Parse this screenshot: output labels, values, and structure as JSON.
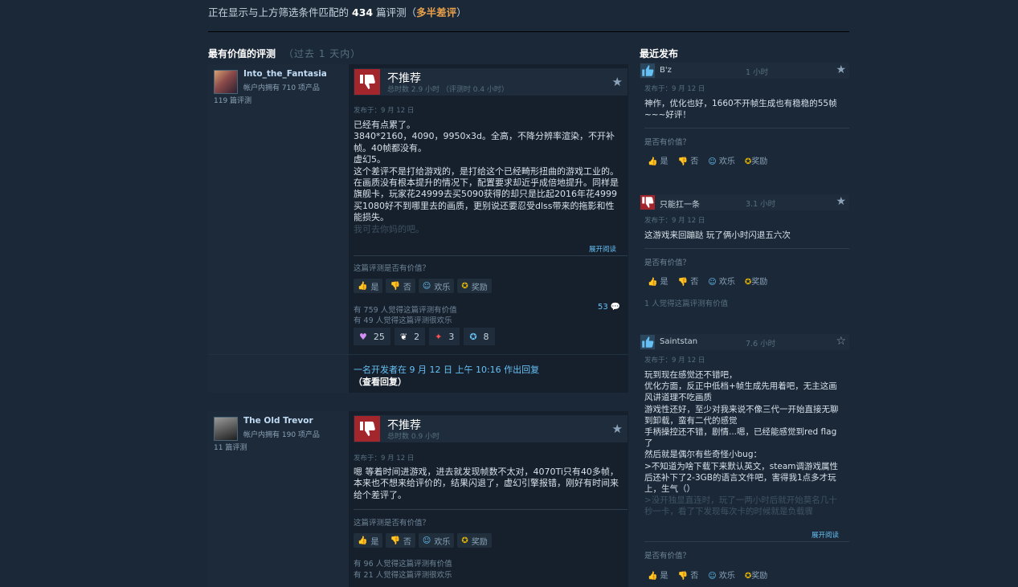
{
  "filter": {
    "prefix": "正在显示与上方筛选条件匹配的",
    "count": "434",
    "suffix": "篇评测（",
    "rating": "多半差评",
    "close": "）"
  },
  "most_helpful": {
    "title": "最有价值的评测",
    "subtitle": "（过去 1 天内）"
  },
  "reviews": [
    {
      "author": "Into_the_Fantasia",
      "owned": "帐户内拥有 710 项产品",
      "num_reviews": "119 篇评测",
      "verdict": "不推荐",
      "hours": "总时数 2.9 小时 （评测时 0.4 小时）",
      "posted": "发布于：9 月 12 日",
      "lines": [
        "已经有点累了。",
        "3840*2160，4090，9950x3d。全高，不降分辨率渲染，不开补帧。40帧都没有。",
        "虚幻5。",
        "这个差评不是打给游戏的，是打给这个已经畸形扭曲的游戏工业的。在画质没有根本提升的情况下，配置要求却近乎成倍地提升。同样是旗舰卡，玩家花24999去买5090获得的却只是比起2016年花4999买1080好不到哪里去的画质，更别说还要忍受dlss带来的拖影和性能损失。"
      ],
      "faded": "我可去你妈的吧。",
      "expand": "展开阅读",
      "helpful_q": "这篇评测是否有价值？",
      "btn_yes": "是",
      "btn_no": "否",
      "btn_funny": "欢乐",
      "btn_award": "奖励",
      "stat_helpful": "有 759 人觉得这篇评测有价值",
      "stat_funny": "有 49 人觉得这篇评测很欢乐",
      "comments": "53",
      "reactions": [
        "25",
        "2",
        "3",
        "8"
      ],
      "dev_reply": "一名开发者在 9 月 12 日 上午 10:16 作出回复",
      "view_reply": "（查看回复）"
    },
    {
      "author": "The Old Trevor",
      "owned": "帐户内拥有 190 项产品",
      "num_reviews": "11 篇评测",
      "verdict": "不推荐",
      "hours": "总时数 0.9 小时",
      "posted": "发布于：9 月 12 日",
      "lines": [
        "嗯 等着时间进游戏，进去就发现帧数不太对，4070Ti只有40多帧，本来也不想来给评价的，结果闪退了，虚幻引擎报错，刚好有时间来给个差评了。"
      ],
      "helpful_q": "这篇评测是否有价值？",
      "btn_yes": "是",
      "btn_no": "否",
      "btn_funny": "欢乐",
      "btn_award": "奖励",
      "stat_helpful": "有 96 人觉得这篇评测有价值",
      "stat_funny": "有 21 人觉得这篇评测很欢乐"
    }
  ],
  "recent": {
    "title": "最近发布",
    "items": [
      {
        "name": "B'z",
        "hours": "1 小时",
        "posted": "发布于：9 月 12 日",
        "lines": [
          "神作，优化也好，1660不开帧生成也有稳稳的55帧~~~好评！"
        ],
        "helpful_q": "是否有价值？",
        "yes": "是",
        "no": "否",
        "funny": "欢乐",
        "award": "奖励"
      },
      {
        "name": "只能扛一条",
        "hours": "3.1 小时",
        "posted": "发布于：9 月 12 日",
        "lines": [
          "这游戏来回蹦跶 玩了俩小时闪退五六次"
        ],
        "helpful_q": "是否有价值？",
        "yes": "是",
        "no": "否",
        "funny": "欢乐",
        "award": "奖励",
        "stat": "1 人觉得这篇评测有价值"
      },
      {
        "name": "Saintstan",
        "hours": "7.6 小时",
        "posted": "发布于：9 月 12 日",
        "lines": [
          "玩到现在感觉还不错吧，",
          "优化方面，反正中低档+帧生成先用着吧，无主这画风讲道理不吃画质",
          "游戏性还好，至少对我来说不像三代一开始直接无聊到卸载，蛮有二代的感觉",
          "手柄操控还不错，剧情...嗯，已经能感觉到red flag了",
          "然后就是偶尔有些奇怪小bug：",
          ">不知道为啥下载下来默认英文，steam调游戏属性后还补下了2-3GB的语言文件吧，害得我1点多才玩上，生气（）",
          ">没开独显直连时，玩了一两小时后就开始莫名几十秒一卡，看了下发现每次卡的时候就是负载骤"
        ],
        "expand": "展开阅读",
        "helpful_q": "是否有价值？",
        "yes": "是",
        "no": "否",
        "funny": "欢乐",
        "award": "奖励"
      }
    ]
  }
}
